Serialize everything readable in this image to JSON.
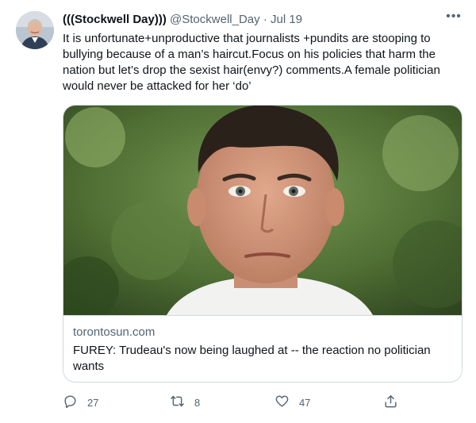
{
  "tweet": {
    "author_name": "(((Stockwell Day)))",
    "handle": "@Stockwell_Day",
    "separator": "·",
    "date": "Jul 19",
    "more_label": "•••",
    "text_lines": [
      "It is unfortunate+unproductive that journalists +pundits are stooping to",
      "bullying because of a man’s haircut.Focus on his policies that harm the",
      "nation but let’s drop the  sexist hair(envy?) comments.A female politician",
      "would never be attacked for her ‘do’"
    ]
  },
  "card": {
    "domain": "torontosun.com",
    "title_lines": [
      "FUREY: Trudeau's now being laughed at -- the reaction no politician",
      "wants"
    ]
  },
  "actions": {
    "reply_count": "27",
    "retweet_count": "8",
    "like_count": "47"
  },
  "colors": {
    "text": "#0f1419",
    "secondary": "#536471",
    "border": "#cfd9de"
  }
}
